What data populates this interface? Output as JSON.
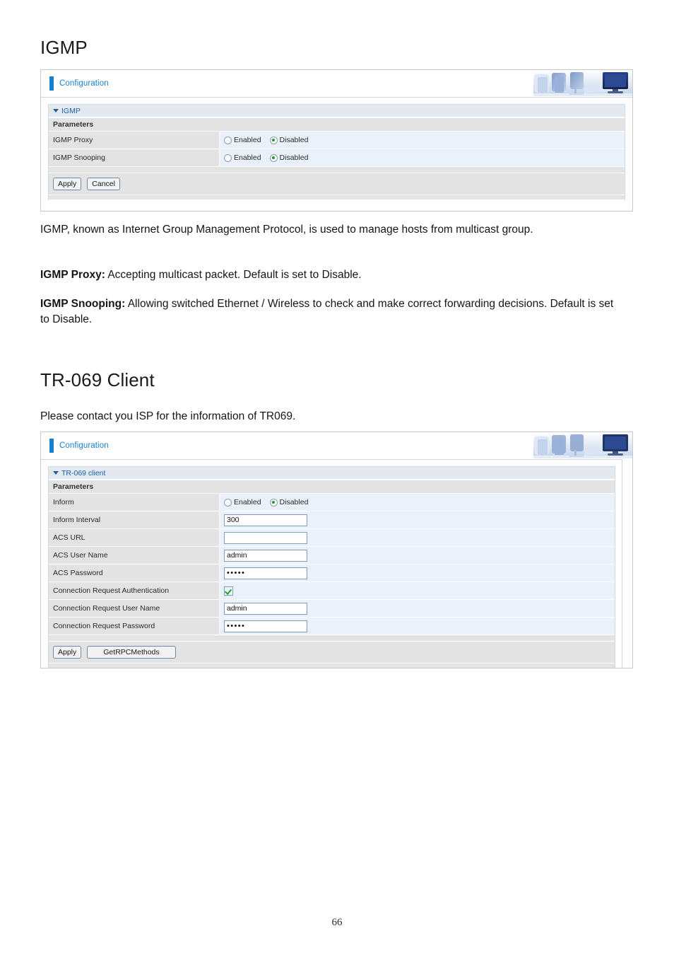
{
  "page": {
    "number": "66"
  },
  "igmp_section": {
    "heading": "IGMP",
    "paragraphs": [
      {
        "lead": "",
        "text": "IGMP, known as Internet Group Management Protocol, is used to manage hosts from multicast group."
      },
      {
        "lead": "IGMP Proxy:",
        "text": " Accepting multicast packet. Default is set to Disable."
      },
      {
        "lead": "IGMP Snooping:",
        "text": " Allowing switched Ethernet / Wireless to check and make correct forwarding decisions. Default is set to Disable."
      }
    ],
    "panel": {
      "titlebar": "Configuration",
      "section_title": "IGMP",
      "params_label": "Parameters",
      "rows": [
        {
          "label": "IGMP Proxy",
          "type": "radio",
          "options": [
            "Enabled",
            "Disabled"
          ],
          "selected": "Disabled"
        },
        {
          "label": "IGMP Snooping",
          "type": "radio",
          "options": [
            "Enabled",
            "Disabled"
          ],
          "selected": "Disabled"
        }
      ],
      "buttons": [
        "Apply",
        "Cancel"
      ]
    }
  },
  "tr069_section": {
    "heading": "TR-069 Client",
    "paragraph": "Please contact you ISP for the information of TR069.",
    "panel": {
      "titlebar": "Configuration",
      "section_title": "TR-069 client",
      "params_label": "Parameters",
      "rows": [
        {
          "label": "Inform",
          "type": "radio",
          "options": [
            "Enabled",
            "Disabled"
          ],
          "selected": "Disabled"
        },
        {
          "label": "Inform Interval",
          "type": "text",
          "value": "300"
        },
        {
          "label": "ACS URL",
          "type": "text",
          "value": ""
        },
        {
          "label": "ACS User Name",
          "type": "text",
          "value": "admin"
        },
        {
          "label": "ACS Password",
          "type": "password",
          "value": "•••••"
        },
        {
          "label": "Connection Request Authentication",
          "type": "checkbox",
          "checked": true
        },
        {
          "label": "Connection Request User Name",
          "type": "text",
          "value": "admin"
        },
        {
          "label": "Connection Request Password",
          "type": "password",
          "value": "•••••"
        }
      ],
      "buttons": [
        "Apply",
        "GetRPCMethods"
      ]
    }
  },
  "colors": {
    "accent_blue": "#1a7fc9",
    "section_title_blue": "#1a5fa8",
    "label_gray": "#e3e3e3",
    "value_blue": "#eaf1fa",
    "radio_green": "#159b2f"
  }
}
